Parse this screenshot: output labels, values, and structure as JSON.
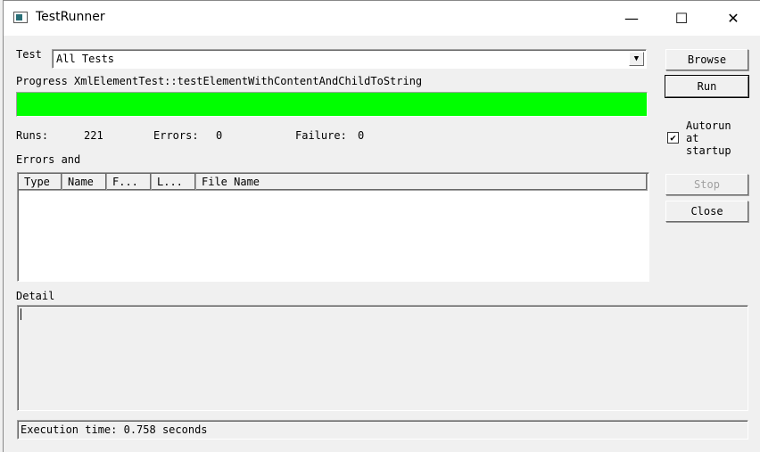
{
  "window": {
    "title": "TestRunner",
    "minimize": "—",
    "maximize": "☐",
    "close": "✕"
  },
  "test": {
    "label": "Test",
    "value": "All Tests"
  },
  "progress": {
    "label": "Progress",
    "current_test": "XmlElementTest::testElementWithContentAndChildToString",
    "percent": 100,
    "color": "#00ff00"
  },
  "stats": {
    "runs_label": "Runs:",
    "runs": "221",
    "errors_label": "Errors:",
    "errors": "0",
    "failure_label": "Failure:",
    "failures": "0"
  },
  "errors_list": {
    "label": "Errors and",
    "columns": [
      "Type",
      "Name",
      "F...",
      "L...",
      "File Name"
    ]
  },
  "detail": {
    "label": "Detail"
  },
  "status": {
    "text": "Execution time: 0.758 seconds"
  },
  "buttons": {
    "browse": "Browse",
    "run": "Run",
    "stop": "Stop",
    "close": "Close"
  },
  "autorun": {
    "label_lines": [
      "Autorun",
      "at",
      "startup"
    ],
    "checked": true
  }
}
